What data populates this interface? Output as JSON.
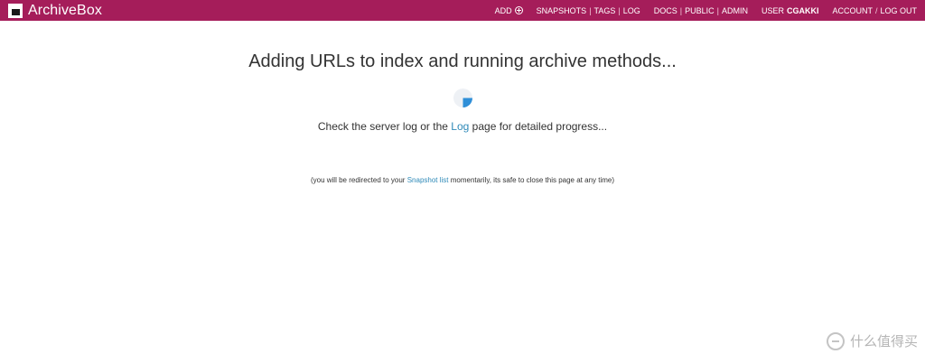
{
  "header": {
    "app_name": "ArchiveBox",
    "bg_color": "#a51d5a",
    "nav": {
      "add": "ADD",
      "snapshots": "SNAPSHOTS",
      "tags": "TAGS",
      "log": "LOG",
      "docs": "DOCS",
      "public": "PUBLIC",
      "admin": "ADMIN",
      "user_label": "USER",
      "user_name": "CGAKKI",
      "account": "ACCOUNT",
      "logout": "LOG OUT",
      "separator": "|",
      "slash": "/"
    }
  },
  "main": {
    "heading": "Adding URLs to index and running archive methods...",
    "progress": {
      "prefix": "Check the server log or the",
      "link": "Log",
      "suffix": "page for detailed progress..."
    },
    "redirect": {
      "prefix": "(you will be redirected to your",
      "link": "Snapshot list",
      "suffix": "momentarily, its safe to close this page at any time)"
    }
  },
  "watermark": {
    "text": "什么值得买"
  },
  "colors": {
    "accent": "#a51d5a",
    "link": "#2f8ab8",
    "spinner": "#2f8fd8"
  }
}
